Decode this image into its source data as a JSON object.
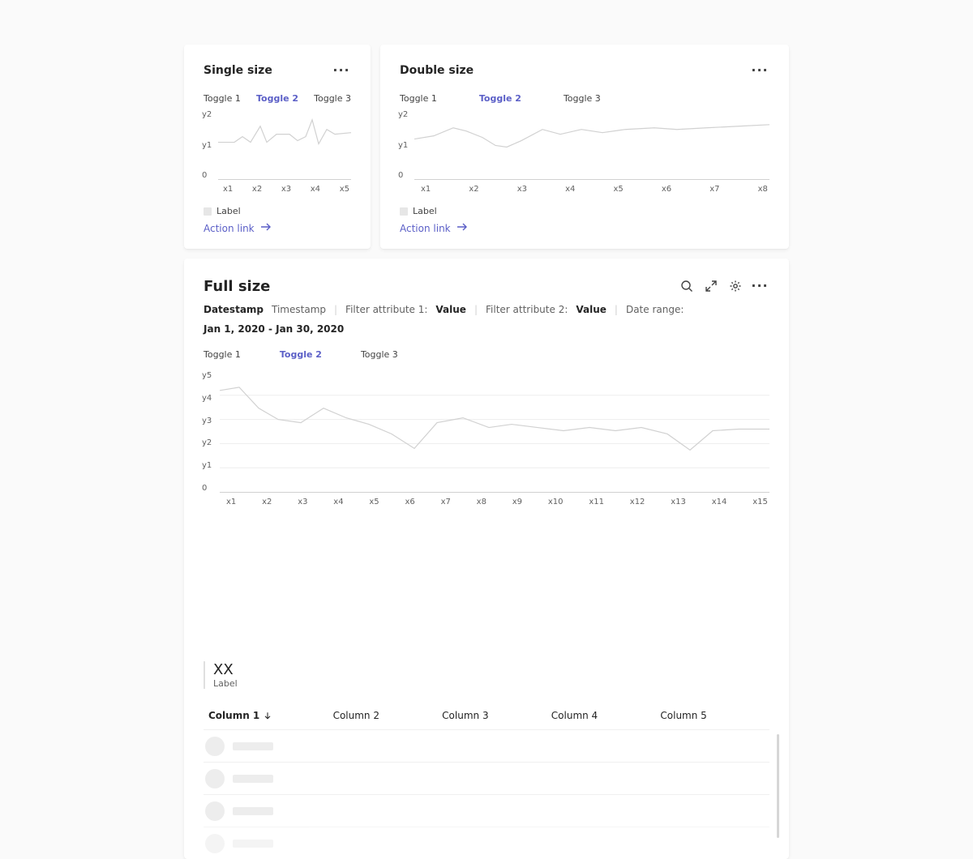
{
  "cards": {
    "single": {
      "title": "Single size",
      "toggles": [
        "Toggle 1",
        "Toggle 2",
        "Toggle 3"
      ],
      "legend": "Label",
      "action": "Action link"
    },
    "double": {
      "title": "Double size",
      "toggles": [
        "Toggle 1",
        "Toggle 2",
        "Toggle 3"
      ],
      "legend": "Label",
      "action": "Action link"
    },
    "full": {
      "title": "Full size",
      "sub": {
        "datestamp": "Datestamp",
        "timestamp": "Timestamp",
        "filter1_label": "Filter attribute 1:",
        "filter1_value": "Value",
        "filter2_label": "Filter attribute 2:",
        "filter2_value": "Value",
        "daterange_label": "Date range:",
        "daterange_value": "Jan 1, 2020 - Jan 30, 2020"
      },
      "toggles": [
        "Toggle 1",
        "Toggle 2",
        "Toggle 3"
      ],
      "kpi_value": "XX",
      "kpi_label": "Label",
      "columns": [
        "Column 1",
        "Column 2",
        "Column 3",
        "Column 4",
        "Column 5"
      ]
    }
  },
  "chart_data": [
    {
      "type": "line",
      "title": "Single size",
      "x": [
        "x1",
        "x2",
        "x3",
        "x4",
        "x5"
      ],
      "y_ticks": [
        "y2",
        "y1",
        "0"
      ],
      "series": [
        {
          "name": "Label",
          "values": [
            1.1,
            1.2,
            1.6,
            1.2,
            1.3
          ]
        }
      ],
      "ylim": [
        0,
        2
      ]
    },
    {
      "type": "line",
      "title": "Double size",
      "x": [
        "x1",
        "x2",
        "x3",
        "x4",
        "x5",
        "x6",
        "x7",
        "x8"
      ],
      "y_ticks": [
        "y2",
        "y1",
        "0"
      ],
      "series": [
        {
          "name": "Label",
          "values": [
            1.2,
            1.5,
            1.0,
            1.3,
            1.4,
            1.5,
            1.55,
            1.6
          ]
        }
      ],
      "ylim": [
        0,
        2
      ]
    },
    {
      "type": "line",
      "title": "Full size",
      "x": [
        "x1",
        "x2",
        "x3",
        "x4",
        "x5",
        "x6",
        "x7",
        "x8",
        "x9",
        "x10",
        "x11",
        "x12",
        "x13",
        "x14",
        "x15"
      ],
      "y_ticks": [
        "y5",
        "y4",
        "y3",
        "y2",
        "y1",
        "0"
      ],
      "series": [
        {
          "name": "Label",
          "values": [
            4.2,
            3.4,
            2.9,
            3.1,
            2.6,
            1.8,
            2.9,
            2.6,
            2.7,
            2.5,
            2.6,
            2.4,
            1.7,
            2.5,
            2.6
          ]
        }
      ],
      "ylim": [
        0,
        5
      ]
    }
  ]
}
